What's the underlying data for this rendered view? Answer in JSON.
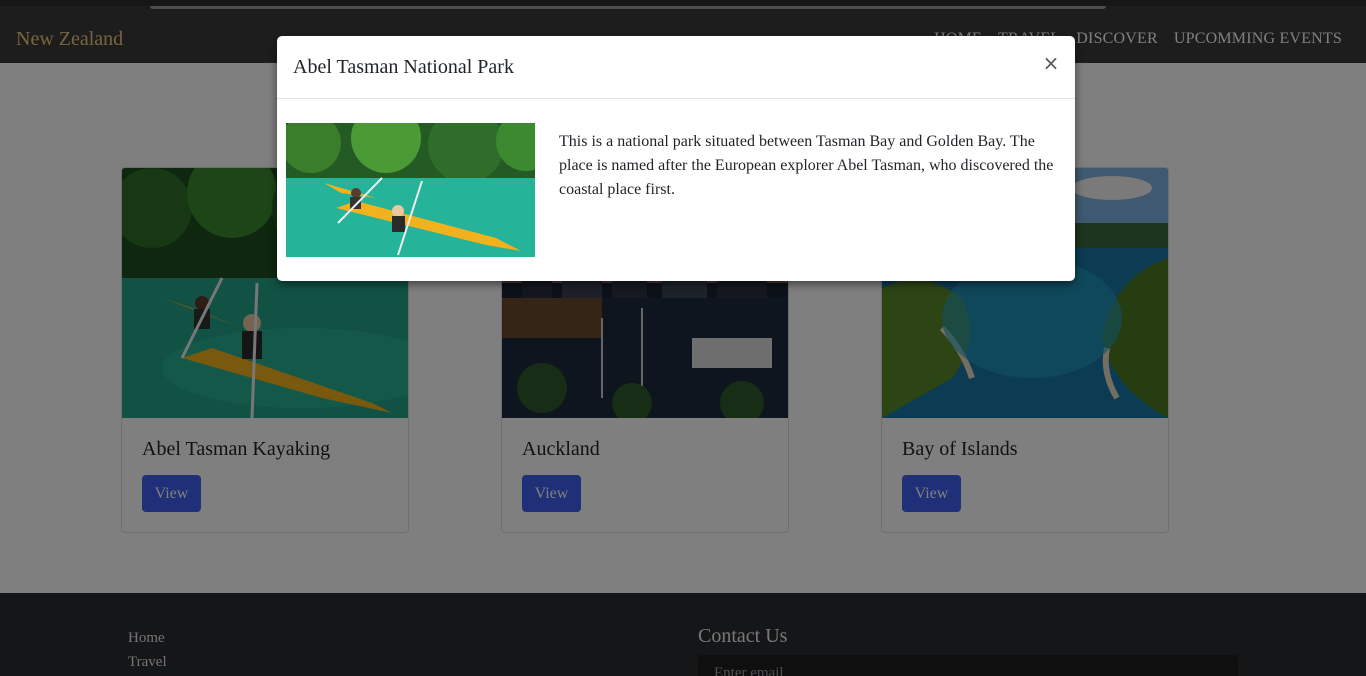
{
  "nav": {
    "brand": "New Zealand",
    "items": [
      {
        "label": "HOME"
      },
      {
        "label": "TRAVEL"
      },
      {
        "label": "DISCOVER"
      },
      {
        "label": "UPCOMMING EVENTS"
      }
    ]
  },
  "cards": [
    {
      "title": "Abel Tasman Kayaking",
      "button_label": "View"
    },
    {
      "title": "Auckland",
      "button_label": "View"
    },
    {
      "title": "Bay of Islands",
      "button_label": "View"
    }
  ],
  "footer": {
    "links": [
      {
        "label": "Home"
      },
      {
        "label": "Travel"
      }
    ],
    "contact_title": "Contact Us",
    "email_placeholder": "Enter email"
  },
  "modal": {
    "title": "Abel Tasman National Park",
    "close_glyph": "×",
    "description": "This is a national park situated between Tasman Bay and Golden Bay. The place is named after the European explorer Abel Tasman, who discovered the coastal place first."
  },
  "colors": {
    "navbar_bg": "#3b3b3b",
    "brand_text": "#f0c87a",
    "button_bg": "#3f5ef0",
    "footer_bg": "#2a2c2e"
  }
}
